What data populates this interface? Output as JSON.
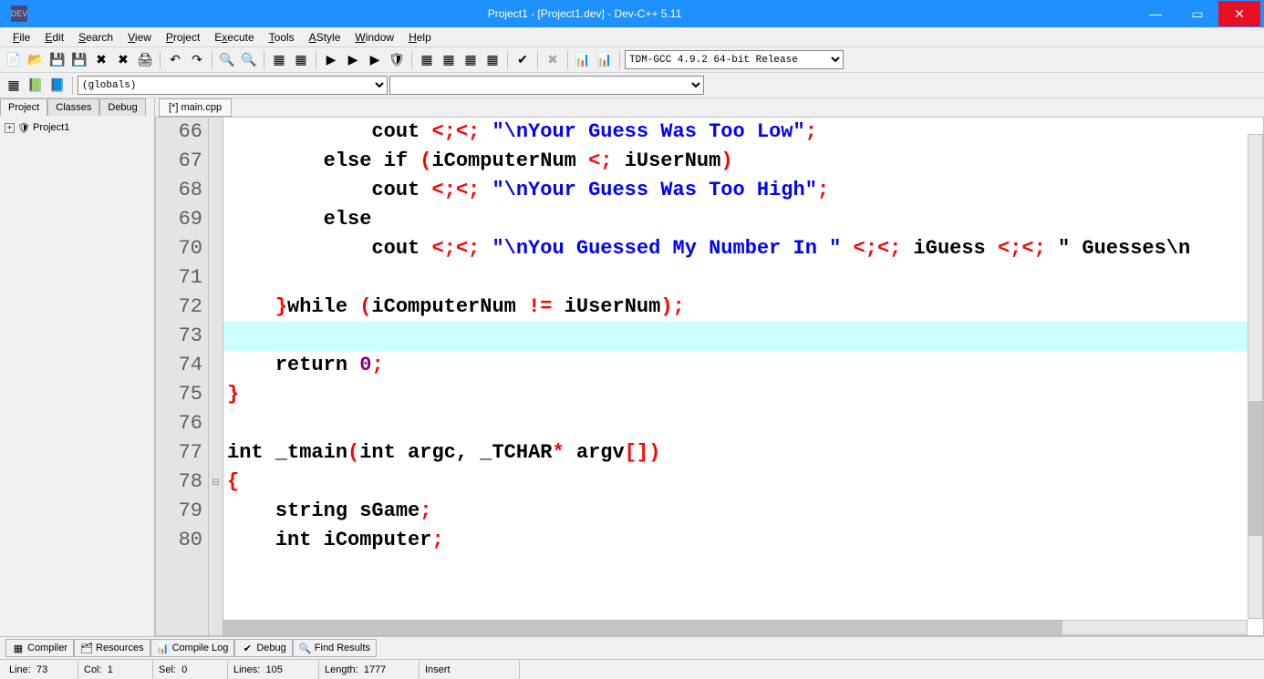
{
  "title": "Project1 - [Project1.dev] - Dev-C++ 5.11",
  "menu": [
    "File",
    "Edit",
    "Search",
    "View",
    "Project",
    "Execute",
    "Tools",
    "AStyle",
    "Window",
    "Help"
  ],
  "compiler_dropdown": "TDM-GCC 4.9.2 64-bit Release",
  "scope_dropdown": "(globals)",
  "left_tabs": [
    "Project",
    "Classes",
    "Debug"
  ],
  "tree_root": "Project1",
  "editor_tab": "[*] main.cpp",
  "code_lines": [
    {
      "n": 66,
      "t": "            cout << \"\\nYour Guess Was Too Low\";"
    },
    {
      "n": 67,
      "t": "        else if (iComputerNum < iUserNum)"
    },
    {
      "n": 68,
      "t": "            cout << \"\\nYour Guess Was Too High\";"
    },
    {
      "n": 69,
      "t": "        else"
    },
    {
      "n": 70,
      "t": "            cout << \"\\nYou Guessed My Number In \" << iGuess << \" Guesses\\n"
    },
    {
      "n": 71,
      "t": ""
    },
    {
      "n": 72,
      "t": "    }while (iComputerNum != iUserNum);"
    },
    {
      "n": 73,
      "t": "",
      "hl": true
    },
    {
      "n": 74,
      "t": "    return 0;"
    },
    {
      "n": 75,
      "t": "}"
    },
    {
      "n": 76,
      "t": ""
    },
    {
      "n": 77,
      "t": "int _tmain(int argc, _TCHAR* argv[])"
    },
    {
      "n": 78,
      "t": "{",
      "fold": true
    },
    {
      "n": 79,
      "t": "    string sGame;"
    },
    {
      "n": 80,
      "t": "    int iComputer;"
    }
  ],
  "bottom_tabs": [
    "Compiler",
    "Resources",
    "Compile Log",
    "Debug",
    "Find Results"
  ],
  "status": {
    "line_lbl": "Line:",
    "line": "73",
    "col_lbl": "Col:",
    "col": "1",
    "sel_lbl": "Sel:",
    "sel": "0",
    "lines_lbl": "Lines:",
    "lines": "105",
    "length_lbl": "Length:",
    "length": "1777",
    "mode": "Insert"
  }
}
